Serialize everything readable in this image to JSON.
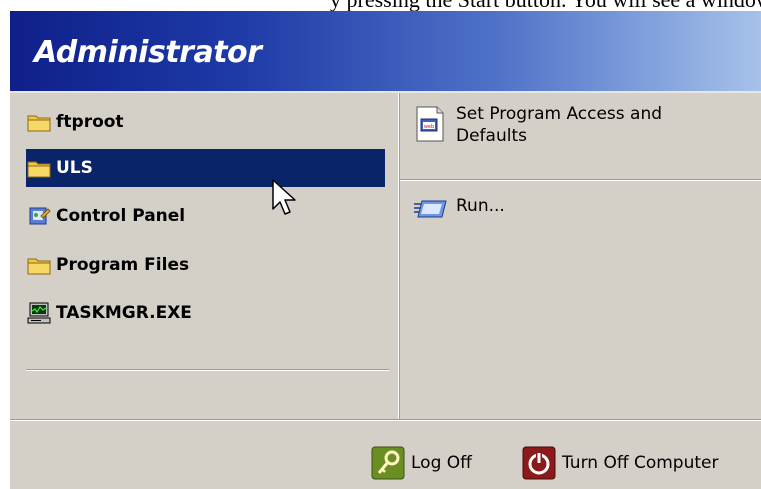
{
  "header": {
    "user_name": "Administrator"
  },
  "background_text": "y pressing the Start button. You will see a window similar to the following.",
  "left_items": [
    {
      "label": "ftproot",
      "icon": "folder-icon"
    },
    {
      "label": "ULS",
      "icon": "folder-icon",
      "selected": true
    },
    {
      "label": "Control Panel",
      "icon": "control-panel-icon"
    },
    {
      "label": "Program Files",
      "icon": "folder-icon"
    },
    {
      "label": "TASKMGR.EXE",
      "icon": "computer-icon"
    }
  ],
  "right_items": [
    {
      "label": "Set Program Access and Defaults",
      "icon": "program-access-icon"
    },
    {
      "label": "Run...",
      "icon": "run-icon"
    }
  ],
  "footer": {
    "log_off": "Log Off",
    "turn_off": "Turn Off Computer"
  },
  "colors": {
    "header_start": "#0f1f8a",
    "header_end": "#a6c2ea",
    "selection": "#0a246a",
    "menu_face": "#d4d0c8",
    "log_off_icon": "#6b8e23",
    "turn_off_icon": "#8b1a1a"
  }
}
